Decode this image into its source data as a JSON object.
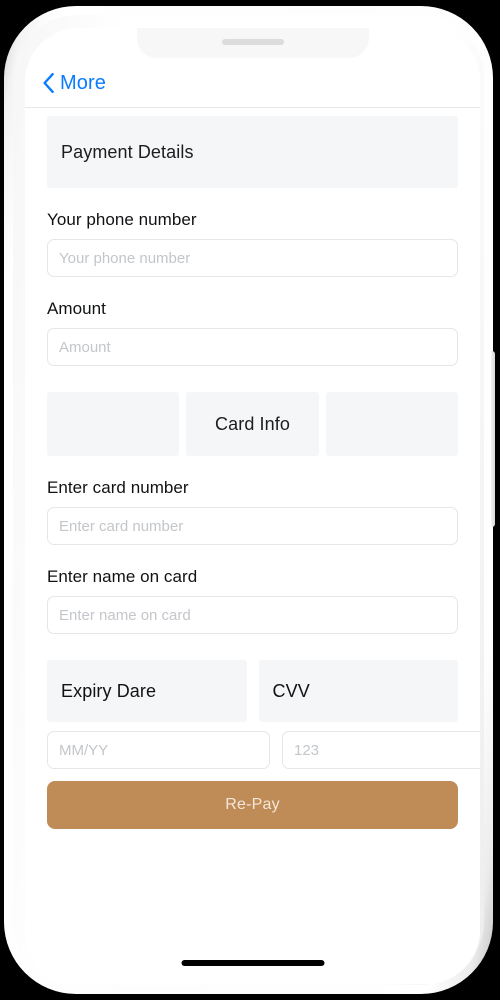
{
  "device": {
    "type": "smartphone-mockup",
    "notch_icon": "speaker-slot",
    "home_indicator_icon": "home-indicator-bar"
  },
  "navbar": {
    "back_icon": "chevron-left-icon",
    "back_label": "More",
    "accent_color": "#0a7cff"
  },
  "screen": {
    "section_header": {
      "title": "Payment Details"
    },
    "fields": [
      {
        "label": "Your phone number",
        "placeholder": "Your phone number",
        "value": ""
      },
      {
        "label": "Amount",
        "placeholder": "Amount",
        "value": ""
      }
    ],
    "card_info_header": {
      "left_label": "",
      "center_label": "Card Info",
      "right_label": ""
    },
    "card_fields": [
      {
        "label": "Enter card number",
        "placeholder": "Enter card number",
        "value": ""
      },
      {
        "label": "Enter name on card",
        "placeholder": "Enter name on card",
        "value": ""
      }
    ],
    "expiry_cvv_header": {
      "expiry_label": "Expiry Dare",
      "cvv_label": "CVV"
    },
    "expiry_cvv_fields": {
      "expiry_placeholder": "MM/YY",
      "expiry_value": "",
      "cvv_placeholder": "123",
      "cvv_value": ""
    },
    "pay_button": {
      "label": "Re-Pay",
      "background_color": "#bf8b57",
      "text_color": "#f4e7d8"
    },
    "panel_color": "#f5f6f8"
  }
}
